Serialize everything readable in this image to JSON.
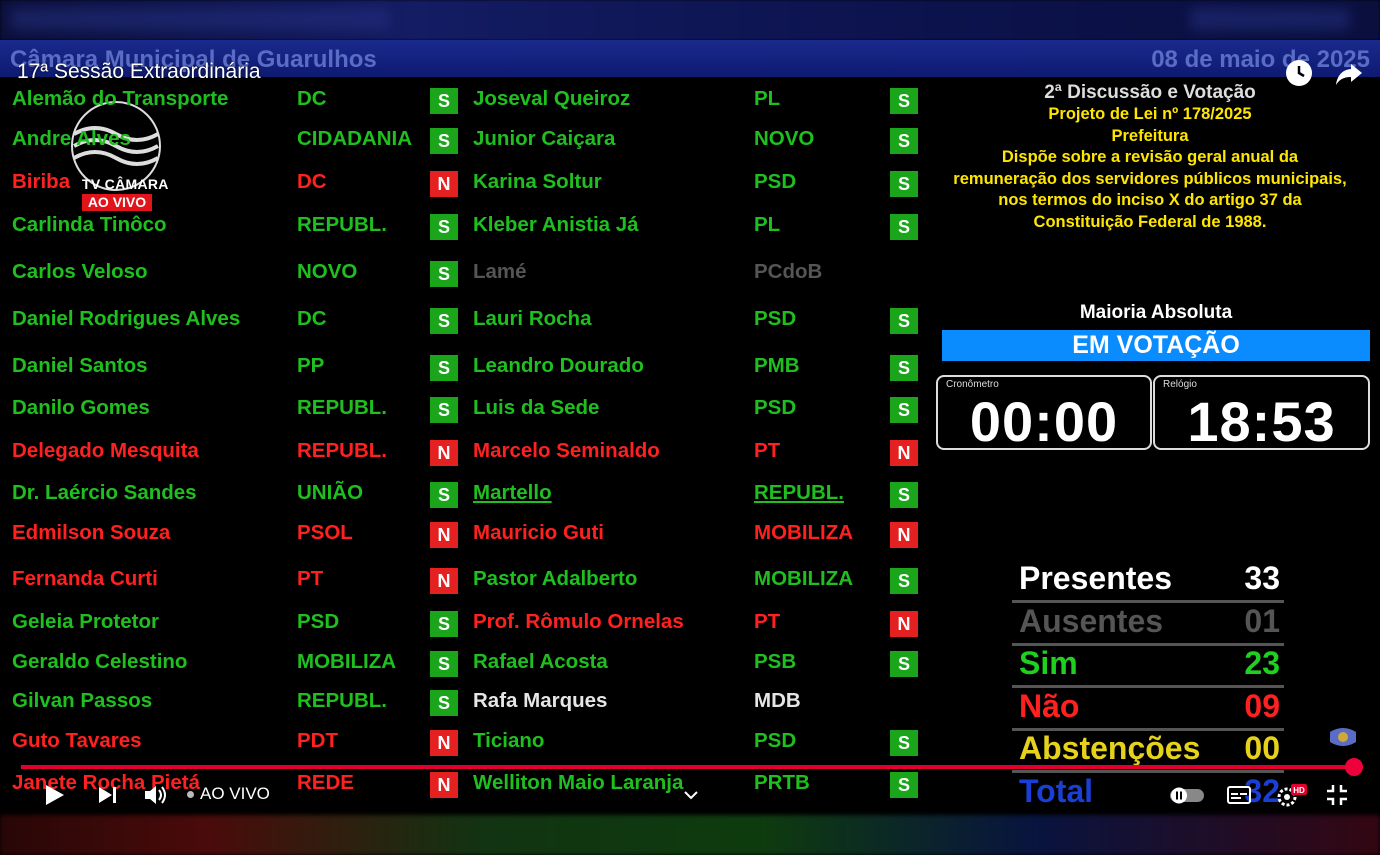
{
  "header": {
    "house_name": "Câmara Municipal de Guarulhos",
    "date": "08 de maio de 2025",
    "session_title": "17ª Sessão Extraordinária"
  },
  "channel": {
    "name": "TV CÂMARA",
    "badge": "AO VIVO"
  },
  "left_column": [
    {
      "name": "Alemão do Transporte",
      "party": "DC",
      "vote": "S",
      "color": "green"
    },
    {
      "name": "Andre Alves",
      "party": "CIDADANIA",
      "vote": "S",
      "color": "green"
    },
    {
      "name": "Biriba",
      "party": "DC",
      "vote": "N",
      "color": "red"
    },
    {
      "name": "Carlinda Tinôco",
      "party": "REPUBL.",
      "vote": "S",
      "color": "green"
    },
    {
      "name": "Carlos Veloso",
      "party": "NOVO",
      "vote": "S",
      "color": "green"
    },
    {
      "name": "Daniel Rodrigues Alves",
      "party": "DC",
      "vote": "S",
      "color": "green"
    },
    {
      "name": "Daniel Santos",
      "party": "PP",
      "vote": "S",
      "color": "green"
    },
    {
      "name": "Danilo Gomes",
      "party": "REPUBL.",
      "vote": "S",
      "color": "green"
    },
    {
      "name": "Delegado Mesquita",
      "party": "REPUBL.",
      "vote": "N",
      "color": "red"
    },
    {
      "name": "Dr. Laércio Sandes",
      "party": "UNIÃO",
      "vote": "S",
      "color": "green"
    },
    {
      "name": "Edmilson Souza",
      "party": "PSOL",
      "vote": "N",
      "color": "red"
    },
    {
      "name": "Fernanda Curti",
      "party": "PT",
      "vote": "N",
      "color": "red"
    },
    {
      "name": "Geleia Protetor",
      "party": "PSD",
      "vote": "S",
      "color": "green"
    },
    {
      "name": "Geraldo Celestino",
      "party": "MOBILIZA",
      "vote": "S",
      "color": "green"
    },
    {
      "name": "Gilvan Passos",
      "party": "REPUBL.",
      "vote": "S",
      "color": "green"
    },
    {
      "name": "Guto Tavares",
      "party": "PDT",
      "vote": "N",
      "color": "red"
    },
    {
      "name": "Janete Rocha Pietá",
      "party": "REDE",
      "vote": "N",
      "color": "red"
    }
  ],
  "right_column": [
    {
      "name": "Joseval Queiroz",
      "party": "PL",
      "vote": "S",
      "color": "green"
    },
    {
      "name": "Junior Caiçara",
      "party": "NOVO",
      "vote": "S",
      "color": "green"
    },
    {
      "name": "Karina Soltur",
      "party": "PSD",
      "vote": "S",
      "color": "green"
    },
    {
      "name": "Kleber Anistia Já",
      "party": "PL",
      "vote": "S",
      "color": "green"
    },
    {
      "name": "Lamé",
      "party": "PCdoB",
      "vote": "",
      "color": "gray"
    },
    {
      "name": "Lauri Rocha",
      "party": "PSD",
      "vote": "S",
      "color": "green"
    },
    {
      "name": "Leandro Dourado",
      "party": "PMB",
      "vote": "S",
      "color": "green"
    },
    {
      "name": "Luis da Sede",
      "party": "PSD",
      "vote": "S",
      "color": "green"
    },
    {
      "name": "Marcelo Seminaldo",
      "party": "PT",
      "vote": "N",
      "color": "red"
    },
    {
      "name": "Martello",
      "party": "REPUBL.",
      "vote": "S",
      "color": "green"
    },
    {
      "name": "Mauricio Guti",
      "party": "MOBILIZA",
      "vote": "N",
      "color": "red"
    },
    {
      "name": "Pastor Adalberto",
      "party": "MOBILIZA",
      "vote": "S",
      "color": "green"
    },
    {
      "name": "Prof. Rômulo Ornelas",
      "party": "PT",
      "vote": "N",
      "color": "red"
    },
    {
      "name": "Rafael Acosta",
      "party": "PSB",
      "vote": "S",
      "color": "green"
    },
    {
      "name": "Rafa Marques",
      "party": "MDB",
      "vote": "",
      "color": "white"
    },
    {
      "name": "Ticiano",
      "party": "PSD",
      "vote": "S",
      "color": "green"
    },
    {
      "name": "Welliton Maio Laranja",
      "party": "PRTB",
      "vote": "S",
      "color": "green"
    }
  ],
  "bill": {
    "stage": "2ª Discussão e Votação",
    "number": "Projeto de Lei nº 178/2025",
    "author": "Prefeitura",
    "summary_lines": [
      "Dispõe sobre a revisão geral anual da",
      "remuneração dos servidores públicos municipais,",
      "nos termos do inciso X do artigo 37 da",
      "Constituição Federal de 1988."
    ]
  },
  "quorum": "Maioria Absoluta",
  "status": "EM VOTAÇÃO",
  "stopwatch": {
    "label": "Cronômetro",
    "value": "00:00"
  },
  "clock": {
    "label": "Relógio",
    "value": "18:53"
  },
  "tally": [
    {
      "label": "Presentes",
      "value": "33",
      "color": "#ffffff"
    },
    {
      "label": "Ausentes",
      "value": "01",
      "color": "#555555"
    },
    {
      "label": "Sim",
      "value": "23",
      "color": "#1fd11f"
    },
    {
      "label": "Não",
      "value": "09",
      "color": "#ff2020"
    },
    {
      "label": "Abstenções",
      "value": "00",
      "color": "#e6d21a"
    },
    {
      "label": "Total",
      "value": "32",
      "color": "#1a3fd6"
    }
  ],
  "player": {
    "live_label": "AO VIVO",
    "progress": 0.995,
    "colors": {
      "accent": "#e1002d"
    }
  }
}
